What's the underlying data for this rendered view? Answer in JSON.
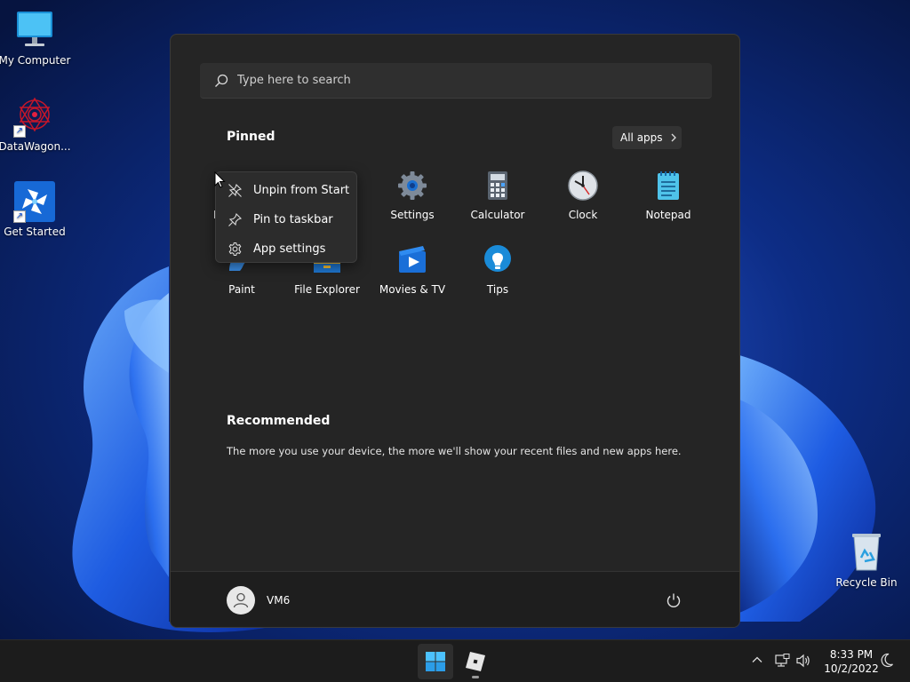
{
  "desktop": {
    "icons": [
      {
        "label": "My Computer",
        "icon": "monitor-icon"
      },
      {
        "label": "DataWagon...",
        "icon": "datawagon-logo-icon"
      },
      {
        "label": "Get Started",
        "icon": "get-started-icon"
      },
      {
        "label": "Recycle Bin",
        "icon": "recycle-bin-icon"
      }
    ]
  },
  "start_menu": {
    "search_placeholder": "Type here to search",
    "pinned_title": "Pinned",
    "all_apps_label": "All apps",
    "pinned_apps": [
      {
        "label": "M",
        "icon": "microsoft-edge-icon"
      },
      {
        "label": "Settings",
        "icon": "gear-icon"
      },
      {
        "label": "Calculator",
        "icon": "calculator-icon"
      },
      {
        "label": "Clock",
        "icon": "clock-icon"
      },
      {
        "label": "Notepad",
        "icon": "notepad-icon"
      },
      {
        "label": "Paint",
        "icon": "paint-icon"
      },
      {
        "label": "File Explorer",
        "icon": "folder-icon"
      },
      {
        "label": "Movies & TV",
        "icon": "movies-tv-icon"
      },
      {
        "label": "Tips",
        "icon": "tips-lightbulb-icon"
      }
    ],
    "recommended_title": "Recommended",
    "recommended_text": "The more you use your device, the more we'll show your recent files and new apps here.",
    "user_name": "VM6"
  },
  "context_menu": {
    "items": [
      {
        "label": "Unpin from Start",
        "icon": "unpin-icon"
      },
      {
        "label": "Pin to taskbar",
        "icon": "pin-icon"
      },
      {
        "label": "App settings",
        "icon": "gear-icon"
      }
    ]
  },
  "taskbar": {
    "time": "8:33 PM",
    "date": "10/2/2022"
  },
  "colors": {
    "accent": "#0078d4",
    "start_bg": "#252525",
    "taskbar_bg": "#1c1c1c"
  }
}
